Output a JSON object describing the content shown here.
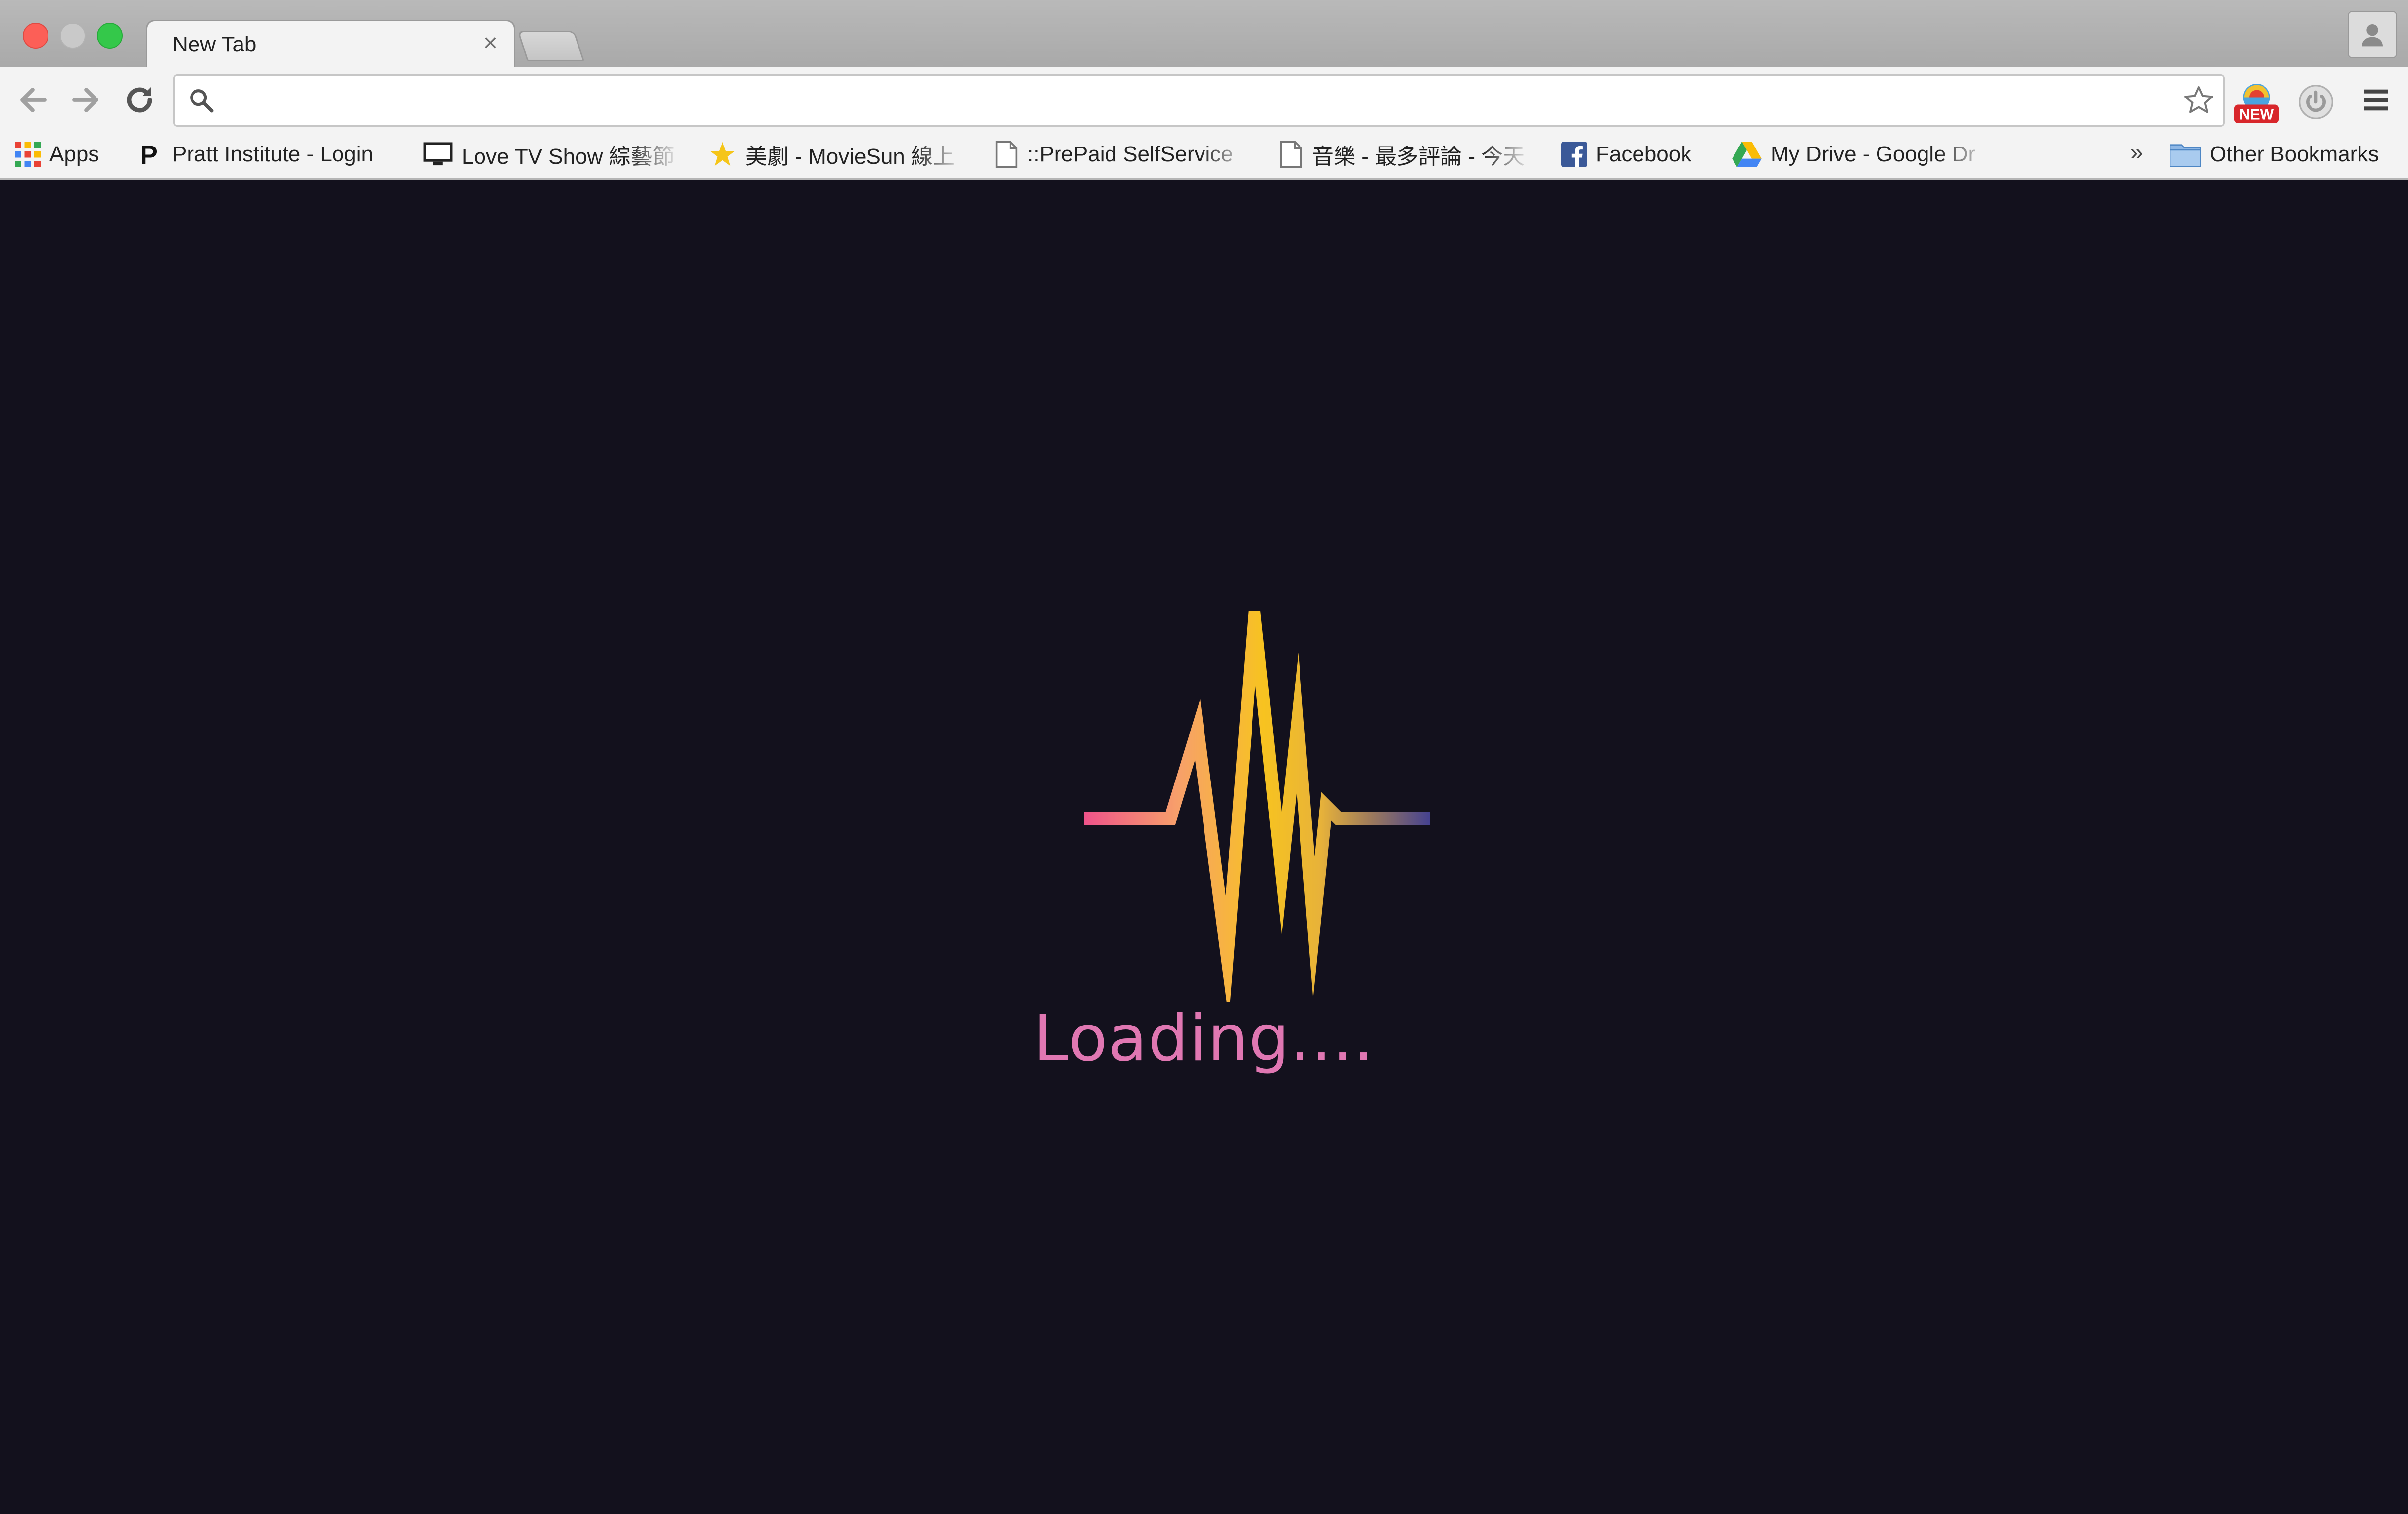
{
  "window": {
    "tab_title": "New Tab",
    "tab_close": "×"
  },
  "toolbar": {
    "omnibox_value": "",
    "extension_badge": "NEW"
  },
  "bookmarks": {
    "items": [
      {
        "label": "Apps",
        "icon": "apps-grid-icon"
      },
      {
        "label": "Pratt Institute - Login",
        "icon": "pratt-p-icon"
      },
      {
        "label": "Love TV Show 綜藝節",
        "icon": "tv-monitor-icon"
      },
      {
        "label": "美劇 - MovieSun 線上",
        "icon": "star-favicon-icon"
      },
      {
        "label": "::PrePaid SelfService",
        "icon": "page-icon"
      },
      {
        "label": "音樂 - 最多評論 - 今天",
        "icon": "page-icon"
      },
      {
        "label": "Facebook",
        "icon": "facebook-icon"
      },
      {
        "label": "My Drive - Google Dr",
        "icon": "google-drive-icon"
      }
    ],
    "overflow": "»",
    "other": "Other Bookmarks"
  },
  "page": {
    "loading_text": "Loading....",
    "colors": {
      "background": "#13111d",
      "pink": "#ee4f8c",
      "orange": "#f7a06a",
      "yellow": "#f7c320",
      "indigo": "#3d3d95",
      "text": "#e077b2"
    }
  }
}
